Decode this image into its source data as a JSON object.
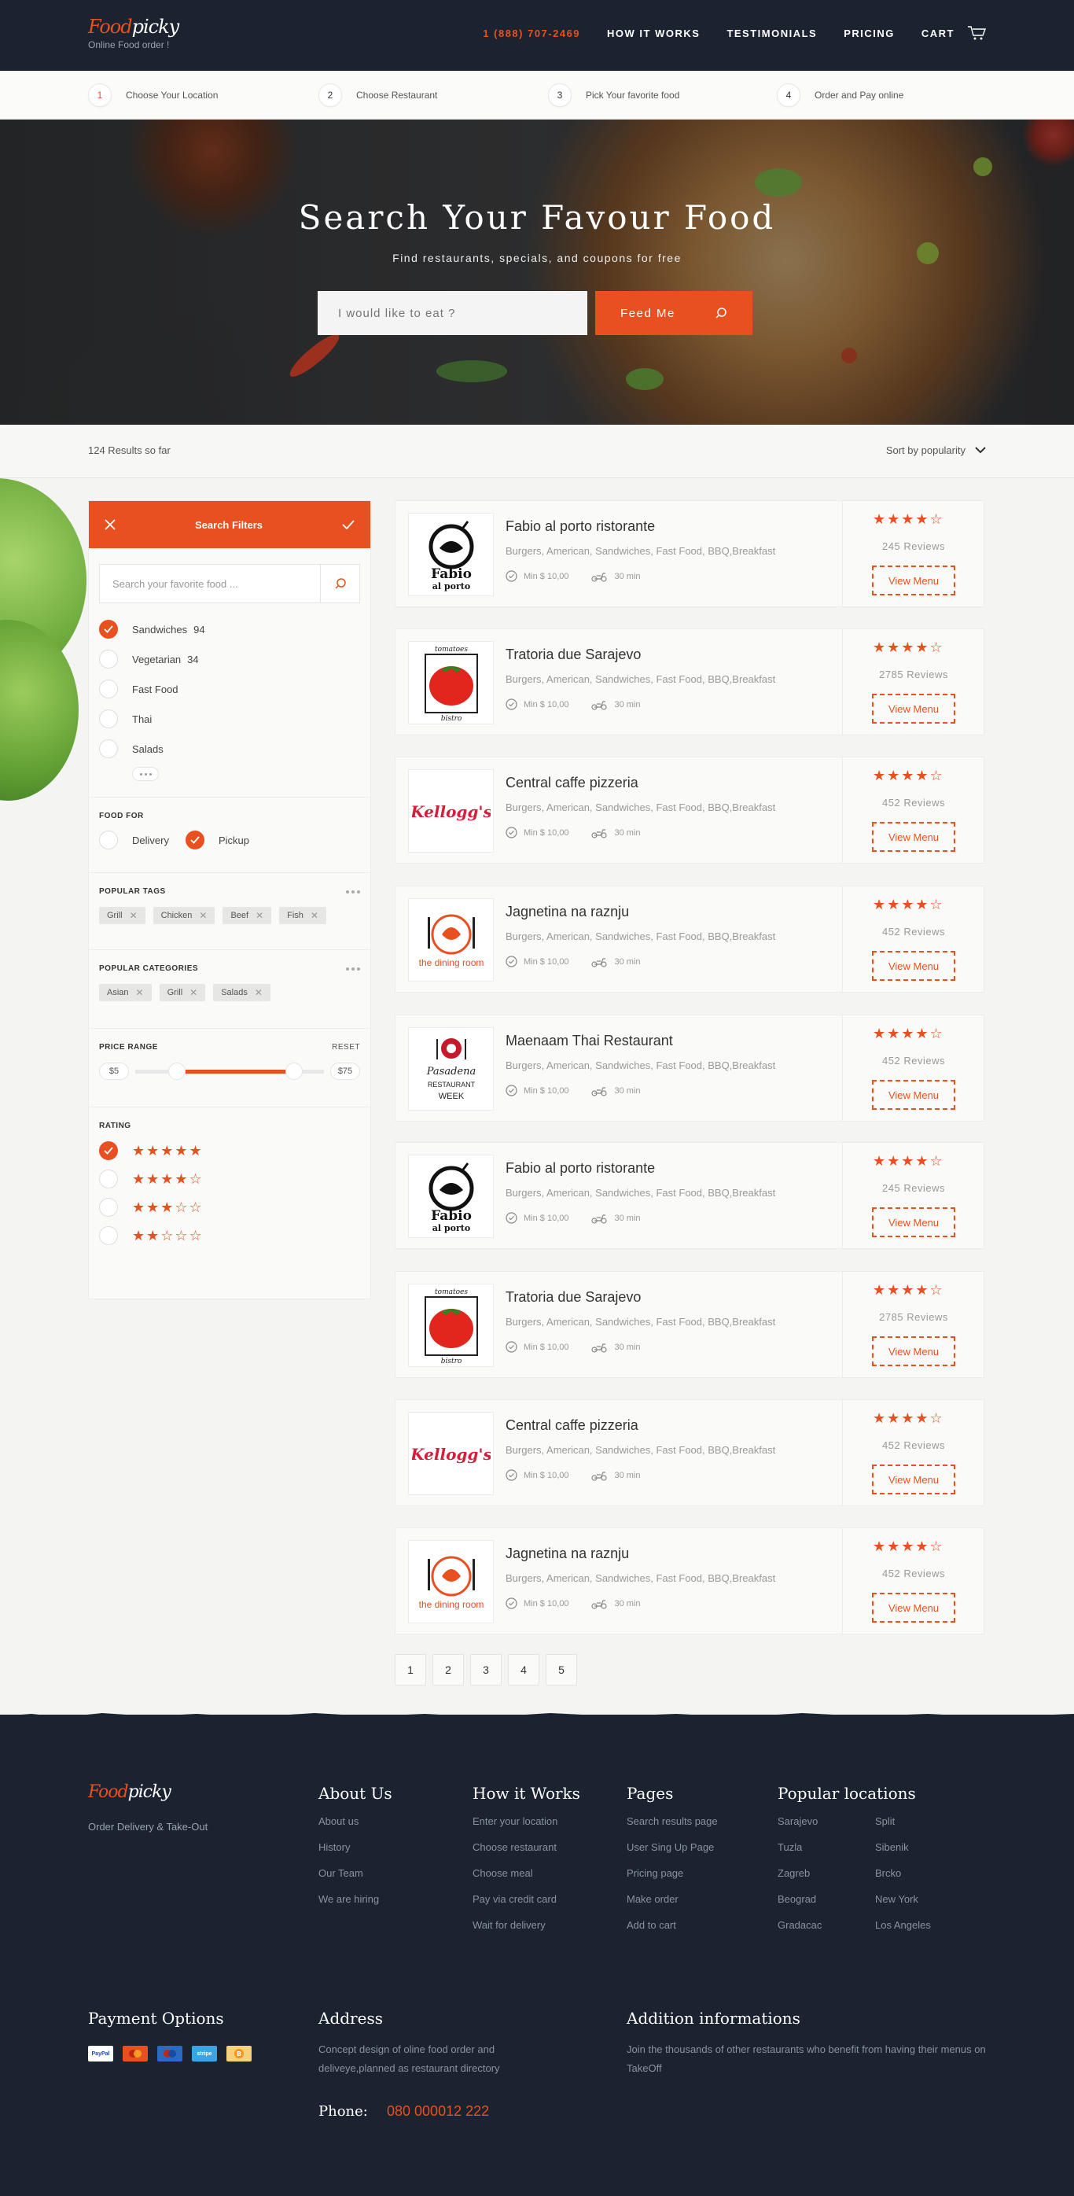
{
  "header": {
    "logo_food": "Food",
    "logo_picky": "picky",
    "tagline": "Online Food order !",
    "phone": "1 (888) 707-2469",
    "nav": [
      "HOW IT WORKS",
      "TESTIMONIALS",
      "PRICING",
      "CART"
    ]
  },
  "steps": [
    {
      "num": "1",
      "label": "Choose Your Location"
    },
    {
      "num": "2",
      "label": "Choose Restaurant"
    },
    {
      "num": "3",
      "label": "Pick Your favorite food"
    },
    {
      "num": "4",
      "label": "Order and Pay online"
    }
  ],
  "hero": {
    "title": "Search Your Favour Food",
    "subtitle": "Find restaurants, specials, and coupons for free",
    "placeholder": "I would like to eat ?",
    "button": "Feed Me"
  },
  "results": {
    "count_text": "124 Results so far",
    "sort_label": "Sort by popularity"
  },
  "filters": {
    "title": "Search Filters",
    "search_placeholder": "Search your favorite food ...",
    "types": [
      {
        "label": "Sandwiches",
        "count": "94",
        "checked": true
      },
      {
        "label": "Vegetarian",
        "count": "34",
        "checked": false
      },
      {
        "label": "Fast Food",
        "count": "",
        "checked": false
      },
      {
        "label": "Thai",
        "count": "",
        "checked": false
      },
      {
        "label": "Salads",
        "count": "",
        "checked": false
      }
    ],
    "food_for_title": "FOOD FOR",
    "food_for": [
      {
        "label": "Delivery",
        "checked": false
      },
      {
        "label": "Pickup",
        "checked": true
      }
    ],
    "tags_title": "POPULAR TAGS",
    "tags": [
      "Grill",
      "Chicken",
      "Beef",
      "Fish"
    ],
    "categories_title": "POPULAR CATEGORIES",
    "categories": [
      "Asian",
      "Grill",
      "Salads"
    ],
    "price_title": "PRICE RANGE",
    "price_reset": "RESET",
    "price_min": "$5",
    "price_max": "$75",
    "rating_title": "RATING",
    "ratings": [
      {
        "stars": "★★★★★",
        "checked": true
      },
      {
        "stars": "★★★★☆",
        "checked": false
      },
      {
        "stars": "★★★☆☆",
        "checked": false
      },
      {
        "stars": "★★☆☆☆",
        "checked": false
      }
    ]
  },
  "restaurants": [
    {
      "name": "Fabio al porto ristorante",
      "categories": "Burgers, American, Sandwiches, Fast Food, BBQ,Breakfast",
      "min": "Min $ 10,00",
      "time": "30 min",
      "stars": "★★★★☆",
      "reviews": "245 Reviews",
      "button": "View Menu",
      "logo": "fabio"
    },
    {
      "name": "Tratoria due Sarajevo",
      "categories": "Burgers, American, Sandwiches, Fast Food, BBQ,Breakfast",
      "min": "Min $ 10,00",
      "time": "30 min",
      "stars": "★★★★☆",
      "reviews": "2785 Reviews",
      "button": "View Menu",
      "logo": "tomato"
    },
    {
      "name": "Central caffe pizzeria",
      "categories": "Burgers, American, Sandwiches, Fast Food, BBQ,Breakfast",
      "min": "Min $ 10,00",
      "time": "30 min",
      "stars": "★★★★☆",
      "reviews": "452 Reviews",
      "button": "View Menu",
      "logo": "kelloggs"
    },
    {
      "name": "Jagnetina na raznju",
      "categories": "Burgers, American, Sandwiches, Fast Food, BBQ,Breakfast",
      "min": "Min $ 10,00",
      "time": "30 min",
      "stars": "★★★★☆",
      "reviews": "452 Reviews",
      "button": "View Menu",
      "logo": "dining"
    },
    {
      "name": "Maenaam Thai Restaurant",
      "categories": "Burgers, American, Sandwiches, Fast Food, BBQ,Breakfast",
      "min": "Min $ 10,00",
      "time": "30 min",
      "stars": "★★★★☆",
      "reviews": "452 Reviews",
      "button": "View Menu",
      "logo": "pasadena"
    },
    {
      "name": "Fabio al porto ristorante",
      "categories": "Burgers, American, Sandwiches, Fast Food, BBQ,Breakfast",
      "min": "Min $ 10,00",
      "time": "30 min",
      "stars": "★★★★☆",
      "reviews": "245 Reviews",
      "button": "View Menu",
      "logo": "fabio"
    },
    {
      "name": "Tratoria due Sarajevo",
      "categories": "Burgers, American, Sandwiches, Fast Food, BBQ,Breakfast",
      "min": "Min $ 10,00",
      "time": "30 min",
      "stars": "★★★★☆",
      "reviews": "2785 Reviews",
      "button": "View Menu",
      "logo": "tomato"
    },
    {
      "name": "Central caffe pizzeria",
      "categories": "Burgers, American, Sandwiches, Fast Food, BBQ,Breakfast",
      "min": "Min $ 10,00",
      "time": "30 min",
      "stars": "★★★★☆",
      "reviews": "452 Reviews",
      "button": "View Menu",
      "logo": "kelloggs"
    },
    {
      "name": "Jagnetina na raznju",
      "categories": "Burgers, American, Sandwiches, Fast Food, BBQ,Breakfast",
      "min": "Min $ 10,00",
      "time": "30 min",
      "stars": "★★★★☆",
      "reviews": "452 Reviews",
      "button": "View Menu",
      "logo": "dining"
    }
  ],
  "logo_text": {
    "fabio_1": "Fabio",
    "fabio_2": "al porto",
    "tomato_top": "tomatoes",
    "tomato_bottom": "bistro",
    "kelloggs": "Kellogg's",
    "dining": "the dining room",
    "pasadena_1": "Pasadena",
    "pasadena_2": "RESTAURANT",
    "pasadena_3": "WEEK"
  },
  "pagination": [
    "1",
    "2",
    "3",
    "4",
    "5"
  ],
  "footer": {
    "logo_food": "Food",
    "logo_picky": "picky",
    "tagline": "Order Delivery & Take-Out",
    "about_title": "About Us",
    "about": [
      "About us",
      "History",
      "Our Team",
      "We are hiring"
    ],
    "how_title": "How it Works",
    "how": [
      "Enter your location",
      "Choose restaurant",
      "Choose meal",
      "Pay via credit card",
      "Wait for delivery"
    ],
    "pages_title": "Pages",
    "pages": [
      "Search results page",
      "User Sing Up Page",
      "Pricing page",
      "Make order",
      "Add to cart"
    ],
    "locations_title": "Popular locations",
    "locations": [
      "Sarajevo",
      "Split",
      "Tuzla",
      "Sibenik",
      "Zagreb",
      "Brcko",
      "Beograd",
      "New York",
      "Gradacac",
      "Los Angeles"
    ],
    "payment_title": "Payment Options",
    "payment_methods": [
      "PayPal",
      "mastercard",
      "maestro",
      "stripe",
      "bitcoin"
    ],
    "address_title": "Address",
    "address_text": "Concept design of oline food order and deliveye,planned as restaurant directory",
    "phone_label": "Phone:",
    "phone_value": "080 000012 222",
    "info_title": "Addition informations",
    "info_text": "Join the thousands of other restaurants who benefit from having their menus on TakeOff"
  },
  "colors": {
    "accent": "#e8501f",
    "dark": "#1b2330"
  }
}
